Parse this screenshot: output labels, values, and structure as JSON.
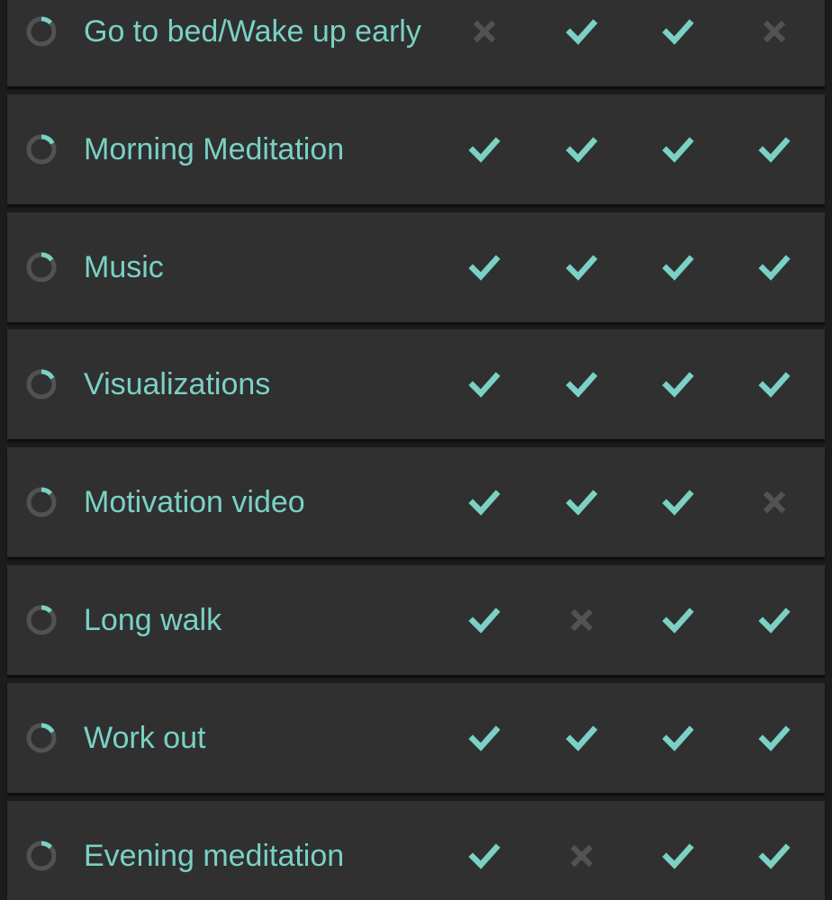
{
  "colors": {
    "accent": "#7ad1c4",
    "inactive": "#525252",
    "row_background": "#303030",
    "page_background": "#1c1c1c"
  },
  "icons": {
    "done": "check-icon",
    "not_done": "cross-icon",
    "score": "progress-ring-icon"
  },
  "habits": [
    {
      "name": "Go to bed/Wake up early",
      "score": 0.13,
      "days": [
        false,
        true,
        true,
        false
      ]
    },
    {
      "name": "Morning Meditation",
      "score": 0.17,
      "days": [
        true,
        true,
        true,
        true
      ]
    },
    {
      "name": "Music",
      "score": 0.15,
      "days": [
        true,
        true,
        true,
        true
      ]
    },
    {
      "name": "Visualizations",
      "score": 0.17,
      "days": [
        true,
        true,
        true,
        true
      ]
    },
    {
      "name": "Motivation video",
      "score": 0.13,
      "days": [
        true,
        true,
        true,
        false
      ]
    },
    {
      "name": "Long walk",
      "score": 0.13,
      "days": [
        true,
        false,
        true,
        true
      ]
    },
    {
      "name": "Work out",
      "score": 0.17,
      "days": [
        true,
        true,
        true,
        true
      ]
    },
    {
      "name": "Evening meditation",
      "score": 0.13,
      "days": [
        true,
        false,
        true,
        true
      ]
    }
  ]
}
